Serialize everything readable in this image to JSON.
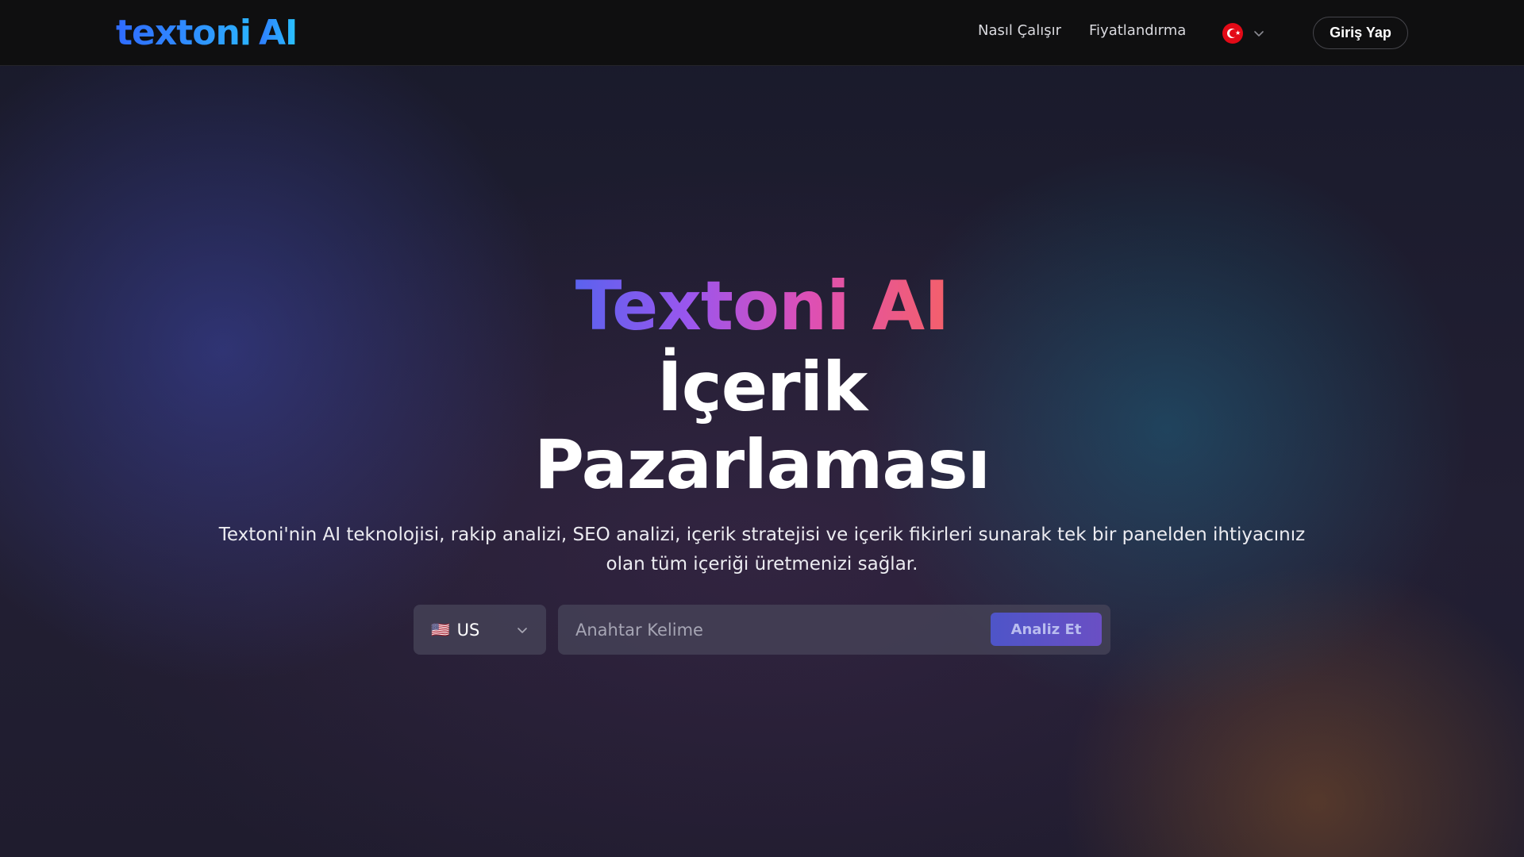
{
  "header": {
    "logo": {
      "text": "textoni",
      "accent": "AI"
    },
    "nav": [
      {
        "label": "Nasıl Çalışır"
      },
      {
        "label": "Fiyatlandırma"
      }
    ],
    "language": {
      "flag_icon": "turkey-flag-icon",
      "chevron_icon": "chevron-down-icon"
    },
    "login_label": "Giriş Yap"
  },
  "hero": {
    "brand": "Textoni AI",
    "line2": "İçerik",
    "line3": "Pazarlaması",
    "subtitle": "Textoni'nin AI teknolojisi, rakip analizi, SEO analizi, içerik stratejisi ve içerik fikirleri sunarak tek bir panelden ihtiyacınız olan tüm içeriği üretmenizi sağlar."
  },
  "search": {
    "country": {
      "flag_glyph": "🇺🇸",
      "code": "US"
    },
    "keyword": {
      "value": "",
      "placeholder": "Anahtar Kelime"
    },
    "analyze_label": "Analiz Et"
  },
  "colors": {
    "header_bg": "#0f0f10",
    "logo_blue": "#2f7cff",
    "brand_gradient": [
      "#5b62ee",
      "#9a56ee",
      "#dd4fb6",
      "#f4606a"
    ],
    "button_gradient": [
      "#4e55c8",
      "#6a4fc4"
    ]
  }
}
